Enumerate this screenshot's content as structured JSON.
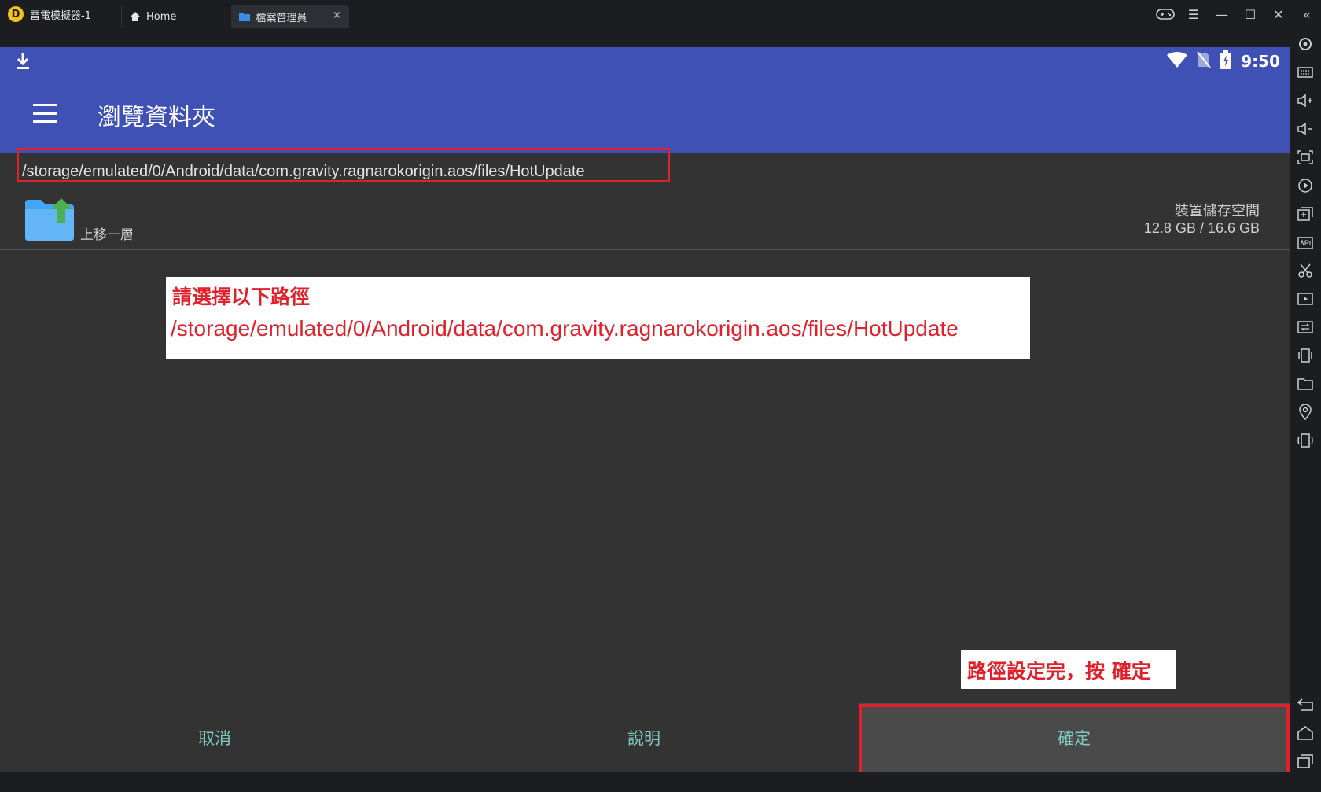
{
  "titlebar": {
    "app_name": "雷電模擬器-1",
    "tabs": [
      {
        "label": "Home"
      },
      {
        "label": "檔案管理員"
      }
    ]
  },
  "statusbar": {
    "time": "9:50"
  },
  "toolbar": {
    "title": "瀏覽資料夾"
  },
  "path": {
    "current": "/storage/emulated/0/Android/data/com.gravity.ragnarokorigin.aos/files/HotUpdate"
  },
  "up_row": {
    "label": "上移一層",
    "storage_name": "裝置儲存空間",
    "storage_size": "12.8 GB / 16.6 GB"
  },
  "note": {
    "title": "請選擇以下路徑",
    "path": "/storage/emulated/0/Android/data/com.gravity.ragnarokorigin.aos/files/HotUpdate"
  },
  "tip": {
    "text": "路徑設定完，按 確定"
  },
  "actions": {
    "cancel": "取消",
    "help": "說明",
    "confirm": "確定"
  },
  "colors": {
    "app_bar": "#3f51b5",
    "background": "#333333",
    "highlight": "#e0202a",
    "button_text": "#7fc8c0"
  }
}
